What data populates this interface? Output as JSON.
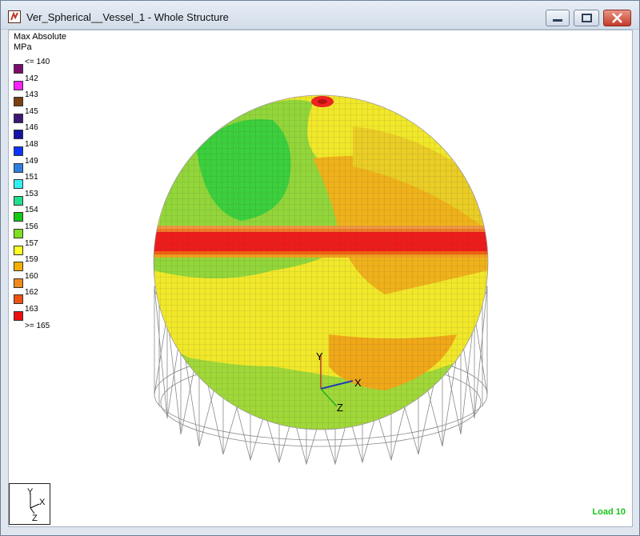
{
  "window": {
    "title": "Ver_Spherical__Vessel_1 - Whole Structure",
    "buttons": {
      "minimize": "minimize",
      "maximize": "maximize",
      "close": "close"
    }
  },
  "legend": {
    "title": "Max Absolute",
    "unit": "MPa",
    "items": [
      {
        "label": "<= 140",
        "color": "#7a0c6e"
      },
      {
        "label": "142",
        "color": "#ff20ff"
      },
      {
        "label": "143",
        "color": "#7a3f12"
      },
      {
        "label": "145",
        "color": "#3b1676"
      },
      {
        "label": "146",
        "color": "#1414a8"
      },
      {
        "label": "148",
        "color": "#0a36ff"
      },
      {
        "label": "149",
        "color": "#2f7fe0"
      },
      {
        "label": "151",
        "color": "#30f0f0"
      },
      {
        "label": "153",
        "color": "#20e08a"
      },
      {
        "label": "154",
        "color": "#13c913"
      },
      {
        "label": "156",
        "color": "#7ee01f"
      },
      {
        "label": "157",
        "color": "#ffff20"
      },
      {
        "label": "159",
        "color": "#f4b000"
      },
      {
        "label": "160",
        "color": "#f08a1a"
      },
      {
        "label": "162",
        "color": "#f05010"
      },
      {
        "label": "163",
        "color": "#ee1010"
      },
      {
        "label": ">= 165",
        "color": ""
      }
    ]
  },
  "axes": {
    "y": "Y",
    "x": "X",
    "z": "Z"
  },
  "triad": {
    "y": "Y",
    "x": "X",
    "z": "Z"
  },
  "status": {
    "load": "Load 10"
  }
}
